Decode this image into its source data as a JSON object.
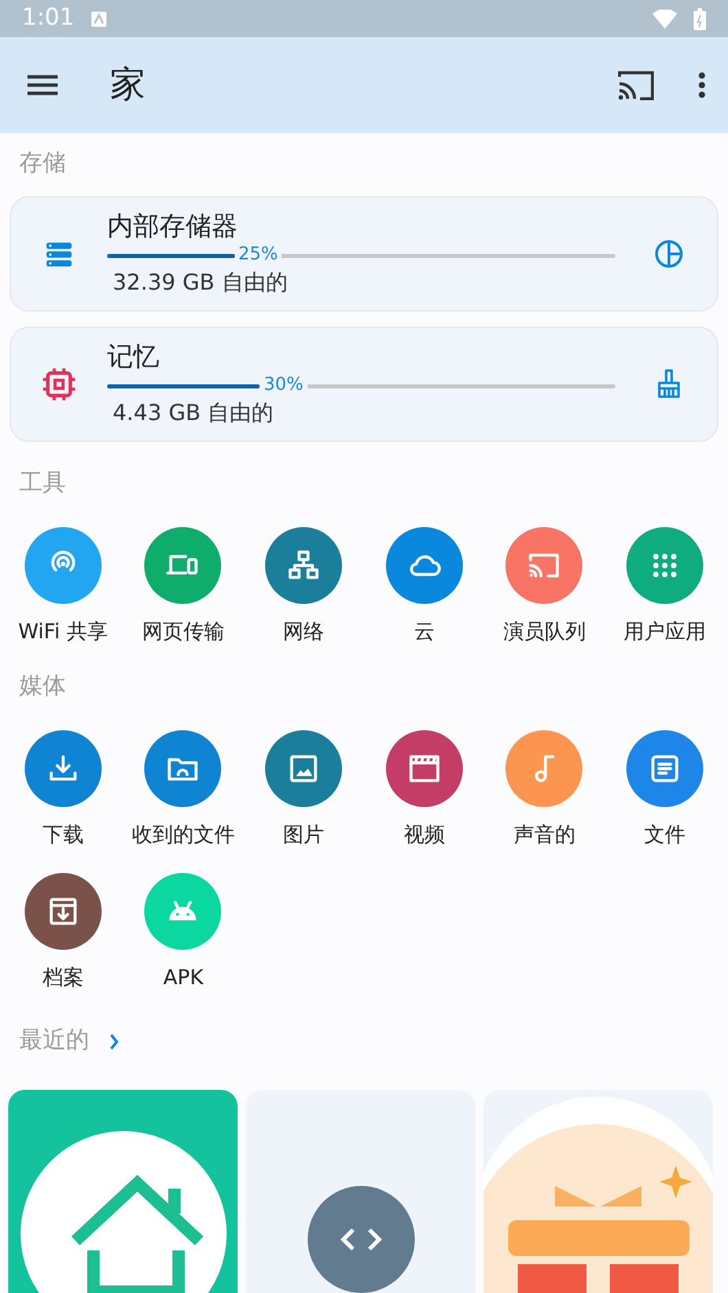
{
  "status_bar": {
    "time": "1:01"
  },
  "app_bar": {
    "title": "家"
  },
  "storage": {
    "title": "存储",
    "items": [
      {
        "name": "内部存储器",
        "level": 0.25,
        "percent": "25%",
        "free": "32.39 GB 自由的"
      },
      {
        "name": "记忆",
        "level": 0.3,
        "percent": "30%",
        "free": "4.43 GB 自由的"
      }
    ]
  },
  "tools": {
    "title": "工具",
    "items": [
      {
        "label": "WiFi 共享",
        "color": "#22a6f2"
      },
      {
        "label": "网页传输",
        "color": "#0fad6b"
      },
      {
        "label": "网络",
        "color": "#1b7f9b"
      },
      {
        "label": "云",
        "color": "#0a88dd"
      },
      {
        "label": "演员队列",
        "color": "#f87565"
      },
      {
        "label": "用户应用",
        "color": "#0eac7f"
      }
    ]
  },
  "media": {
    "title": "媒体",
    "items": [
      {
        "label": "下载",
        "color": "#0f84d2"
      },
      {
        "label": "收到的文件",
        "color": "#0f84d2"
      },
      {
        "label": "图片",
        "color": "#1b7f9b"
      },
      {
        "label": "视频",
        "color": "#c33d66"
      },
      {
        "label": "声音的",
        "color": "#fc9550"
      },
      {
        "label": "文件",
        "color": "#1d86e8"
      },
      {
        "label": "档案",
        "color": "#7b5249"
      },
      {
        "label": "APK",
        "color": "#0bd8a0"
      }
    ]
  },
  "recent": {
    "title": "最近的"
  }
}
